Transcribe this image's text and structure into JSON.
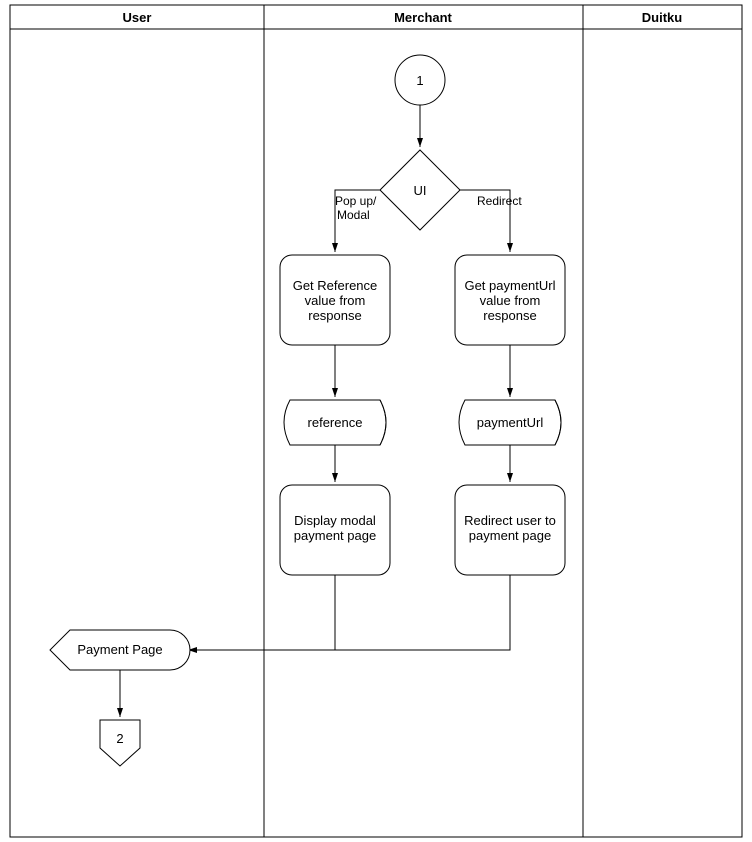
{
  "lanes": {
    "user": "User",
    "merchant": "Merchant",
    "duitku": "Duitku"
  },
  "nodes": {
    "start": "1",
    "ui": "UI",
    "getRef1": "Get Reference",
    "getRef2": "value from",
    "getRef3": "response",
    "dataRef": "reference",
    "dispModal1": "Display modal",
    "dispModal2": "payment page",
    "getUrl1": "Get paymentUrl",
    "getUrl2": "value from",
    "getUrl3": "response",
    "dataUrl": "paymentUrl",
    "redirect1": "Redirect user to",
    "redirect2": "payment page",
    "paymentPage": "Payment Page",
    "end": "2"
  },
  "edges": {
    "popup1": "Pop up/",
    "popup2": "Modal",
    "redirect": "Redirect"
  }
}
